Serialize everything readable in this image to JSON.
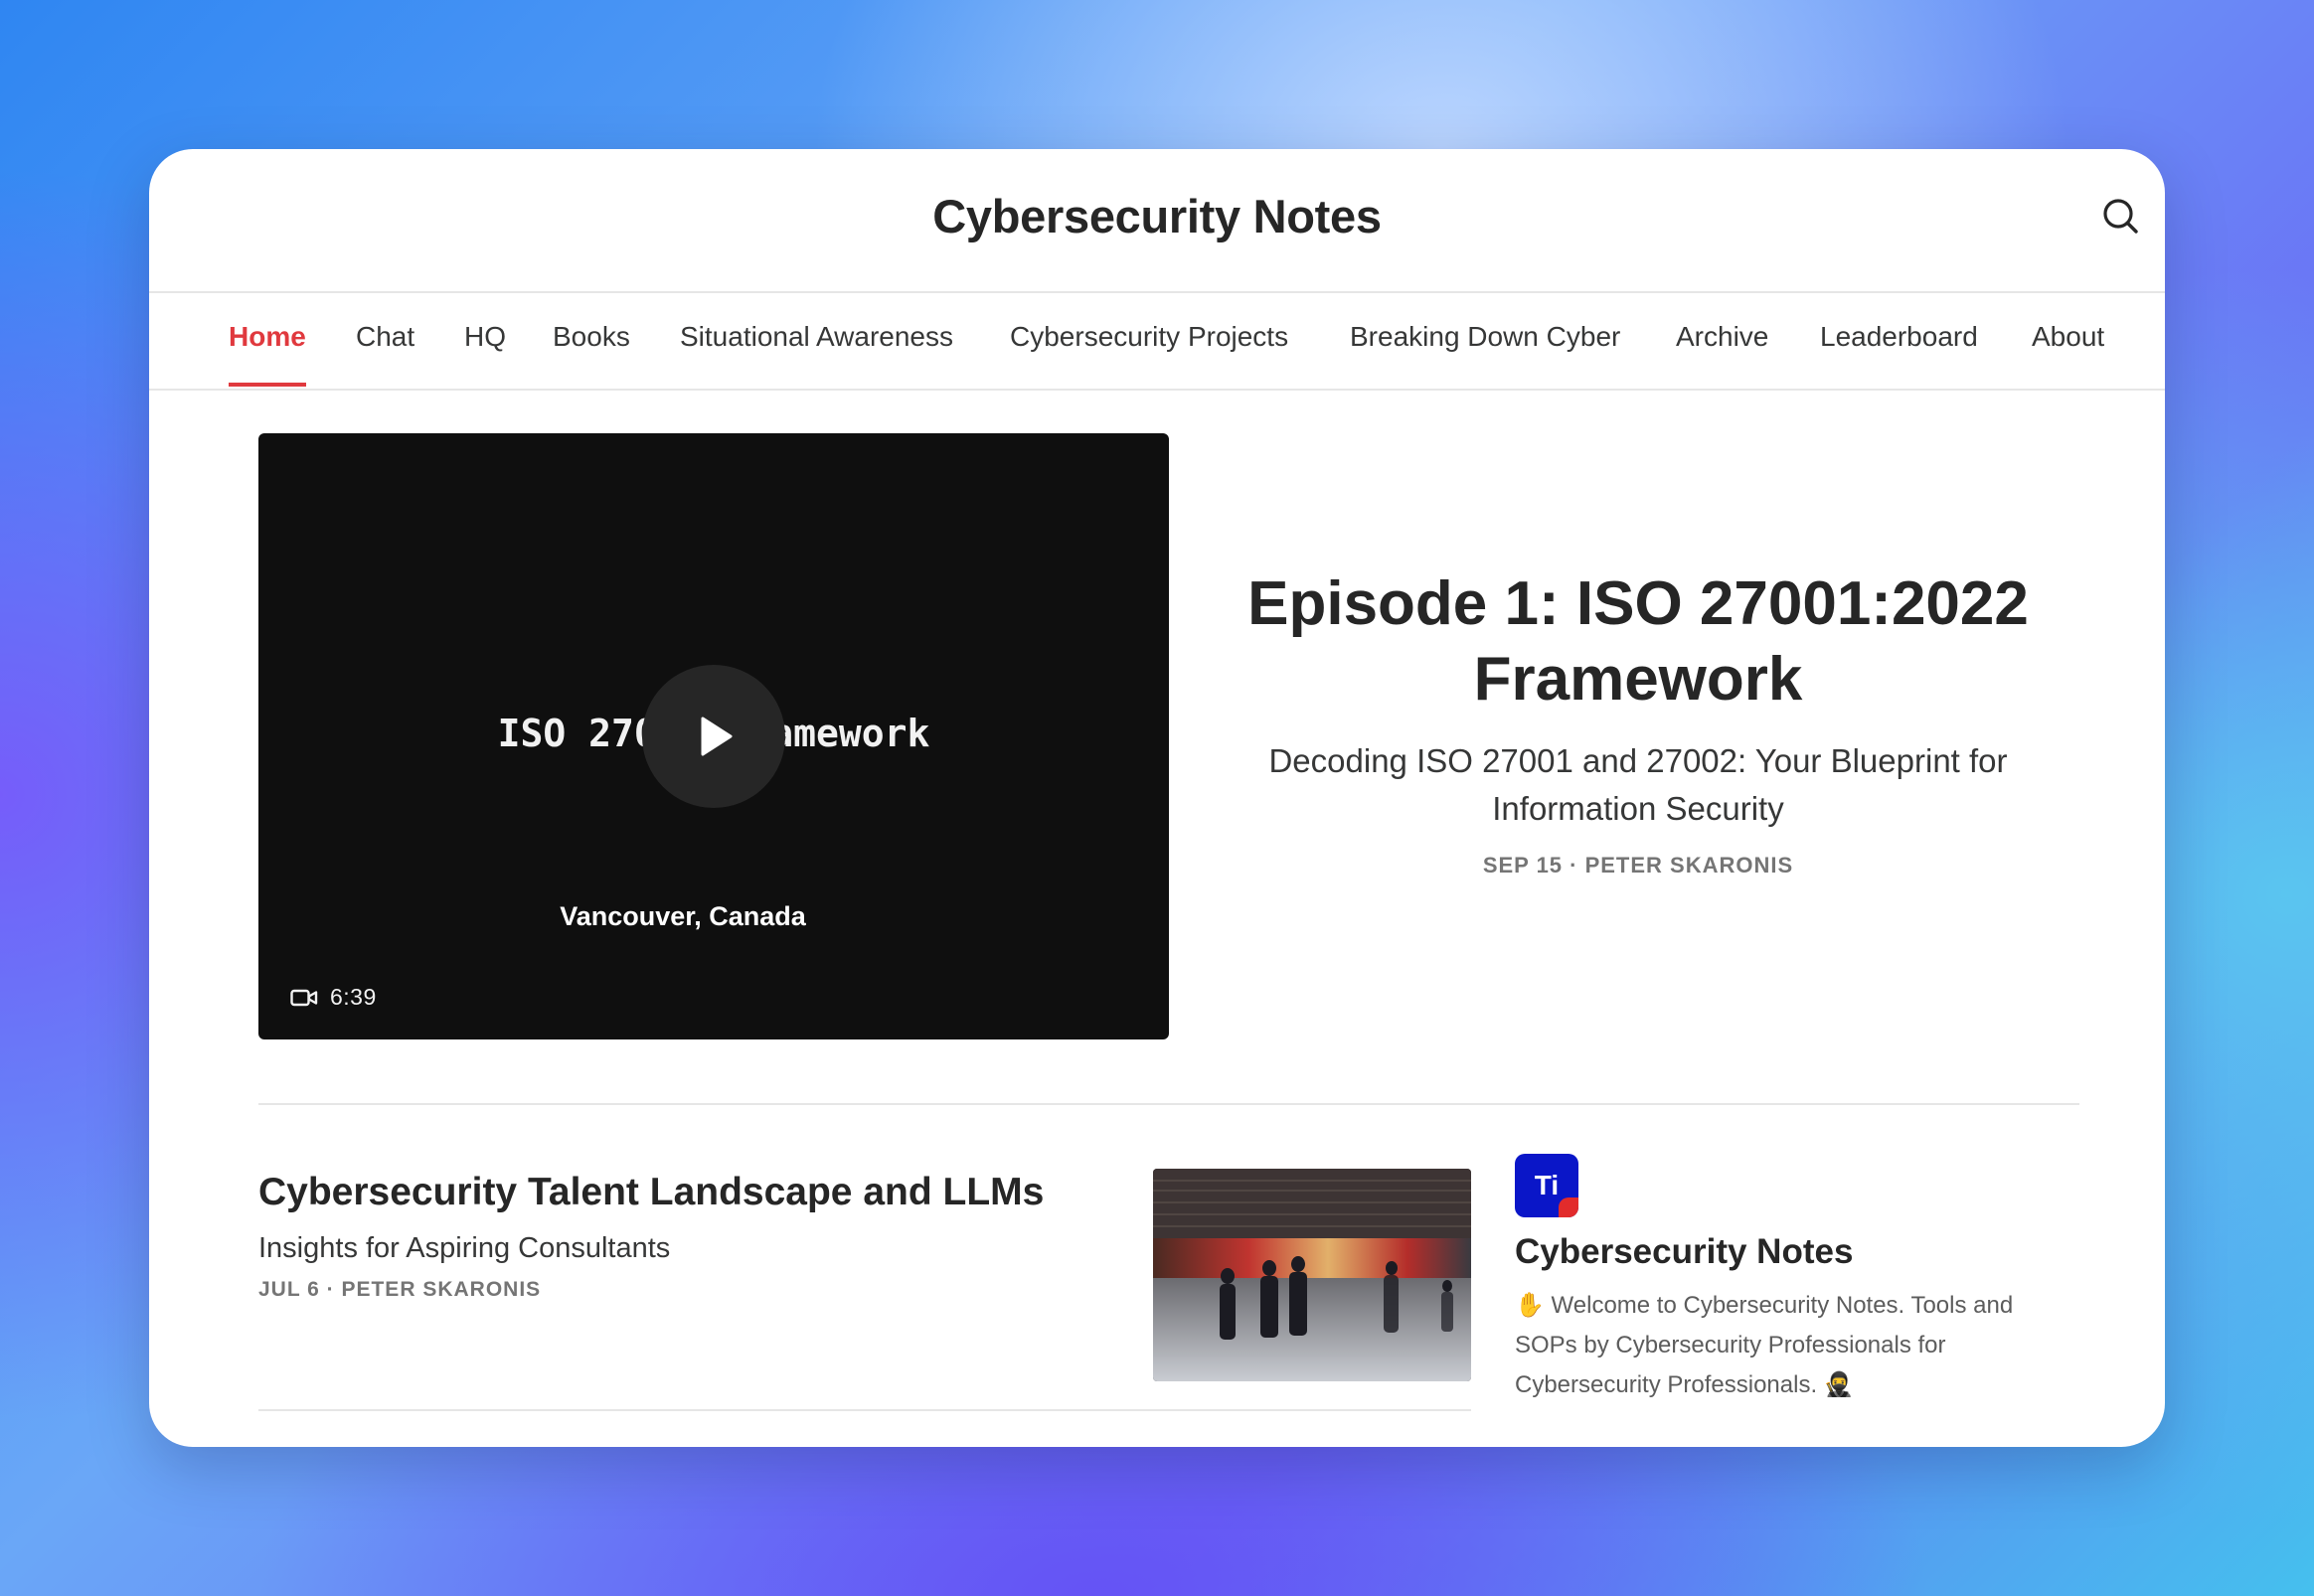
{
  "header": {
    "site_title": "Cybersecurity Notes",
    "search_icon": "search-icon"
  },
  "nav": {
    "items": [
      {
        "label": "Home",
        "active": true
      },
      {
        "label": "Chat"
      },
      {
        "label": "HQ"
      },
      {
        "label": "Books"
      },
      {
        "label": "Situational Awareness"
      },
      {
        "label": "Cybersecurity Projects"
      },
      {
        "label": "Breaking Down Cyber"
      },
      {
        "label": "Archive"
      },
      {
        "label": "Leaderboard"
      },
      {
        "label": "About"
      }
    ],
    "active_color": "#e0393e"
  },
  "featured": {
    "video": {
      "title_text": "ISO 27001 Framework",
      "location": "Vancouver, Canada",
      "duration": "6:39",
      "play_icon": "play-icon",
      "camera_icon": "video-camera-icon"
    },
    "title": "Episode 1: ISO 27001:2022 Framework",
    "subtitle": "Decoding ISO 27001 and 27002: Your Blueprint for Information Security",
    "meta": "SEP 15 · PETER SKARONIS"
  },
  "posts": [
    {
      "title": "Cybersecurity Talent Landscape and LLMs",
      "subtitle": "Insights for Aspiring Consultants",
      "meta": "JUL 6 · PETER SKARONIS"
    }
  ],
  "publication": {
    "logo_text": "Ti",
    "name": "Cybersecurity Notes",
    "description": "✋ Welcome to Cybersecurity Notes. Tools and SOPs by Cybersecurity Professionals for Cybersecurity Professionals. 🥷"
  }
}
